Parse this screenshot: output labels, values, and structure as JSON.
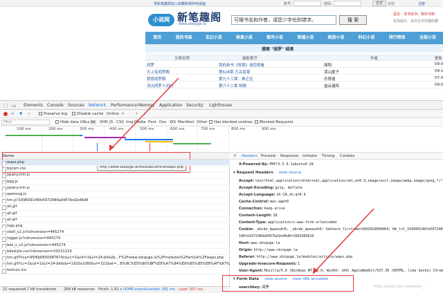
{
  "site": {
    "topbar": {
      "notice": "将新笔趣阁加入收藏和保存到桌面",
      "account_label": "账号:",
      "password_label": "密码:",
      "login_button": "登录",
      "remember": "记住",
      "register": "注册"
    },
    "logo": {
      "badge": "小说网",
      "title": "新笔趣阁",
      "subtitle": "www.xbiquge.la"
    },
    "search": {
      "value": "可搜书名和作者，请您少字也别错字。",
      "button": "搜 索"
    },
    "side_links": [
      "留言：求书找书。我的书架",
      "友情提示：请点击浏览器收藏"
    ],
    "nav": [
      "首页",
      "我的书架",
      "玄幻小说",
      "修真小说",
      "都市小说",
      "穿越小说",
      "网游小说",
      "科幻小说",
      "排行榜单",
      "全部小说"
    ],
    "results_title": "搜索 \"阎罗\" 结果",
    "table_headers": [
      "文章名称",
      "最新章节",
      "作者",
      "更新"
    ],
    "rows": [
      {
        "name": "阎罗",
        "chapter": "我的新书《将夜》请您观看",
        "author": "简阳",
        "date": "09-0"
      },
      {
        "name": "天上有阎罗殿",
        "chapter": "第628章 万古有尊",
        "author": "漆山墨子",
        "date": "09-1"
      },
      {
        "name": "我修阎罗殿",
        "chapter": "第九十三章：神之往",
        "author": "乐得逍",
        "date": "07-0"
      },
      {
        "name": "流光阎罗人间行",
        "chapter": "第六十二章 相救",
        "author": "益云涵风",
        "date": "09-0"
      }
    ]
  },
  "devtools": {
    "tabs": [
      "Elements",
      "Console",
      "Sources",
      "Network",
      "Performance",
      "Memory",
      "Application",
      "Security",
      "Lighthouse"
    ],
    "active_tab": "Network",
    "toolbar1": {
      "preserve_log": "Preserve log",
      "disable_cache": "Disable cache",
      "online": "Online"
    },
    "filter_placeholder": "Filter",
    "toolbar2": {
      "hide_data_urls": "Hide data URLs",
      "types": [
        "All",
        "XHR",
        "JS",
        "CSS",
        "Img",
        "Media",
        "Font",
        "Doc",
        "WS",
        "Manifest",
        "Other"
      ],
      "active_type": "All",
      "blocked_cookies": "Has blocked cookies",
      "blocked_requests": "Blocked Requests"
    },
    "timeline_labels": [
      "100 ms",
      "200 ms",
      "300 ms",
      "400 ms",
      "500 ms",
      "600 ms",
      "700 ms",
      "800 ms",
      "900 ms"
    ],
    "name_header": "Name",
    "requests": [
      "waps.php",
      "bqcsm.css",
      "jquery.min.js",
      "bqg.js",
      "jquery.min.js",
      "opensug.js",
      "hm.js?169609146fe5972484a0957bd1b46d6",
      "all.gif",
      "all.gif",
      "all.gif",
      "logo.png",
      "shell_v2.js?cdnversion=445274",
      "logger.js?cdnversion=445274",
      "bds_s_v2.js?cdnversion=445274",
      "bdsstyle.css?cdnversion=20131219",
      "hm.gif?hca=95f6b6850087670c&cc=1&ck=1&cl=24-bit&ds...F%2Fwww.xbiquge.la%2Fmodules%2Farticle%2Fwaps.php",
      "hm.gif?cc=1&ck=1&cl=24-bit&ds=1920x1080&vl=321&et=...8%9C%E5%80%BF%E8%A7%84%E9%85%85%E8%AF%87%E7%",
      "favicon.ico"
    ],
    "tooltip": "http://www.xbiquge.la/modules/article/waps.php",
    "status": {
      "requests": "21 requests",
      "transferred": "4.7 kB transferred",
      "resources": "268 kB resources",
      "finish": "Finish: 1.61 s",
      "dcl": "DOMContentLoaded: 281 ms",
      "load": "Load: 507 ms"
    },
    "headers_tabs": [
      "Headers",
      "Preview",
      "Response",
      "Initiator",
      "Timing",
      "Cookies"
    ],
    "x_powered_by": {
      "name": "X-Powered-By:",
      "value": "PHP/5.5.9-1ubuntu4.29"
    },
    "request_headers_title": "Request Headers",
    "view_source": "view source",
    "request_headers": [
      {
        "name": "Accept:",
        "value": "text/html,application/xhtml+xml,application/xml;q=0.9,image/avif,image/webp,image/apng,*/*;q"
      },
      {
        "name": "Accept-Encoding:",
        "value": "gzip, deflate"
      },
      {
        "name": "Accept-Language:",
        "value": "zh-CN,zh;q=0.9"
      },
      {
        "name": "Cache-Control:",
        "value": "max-age=0"
      },
      {
        "name": "Connection:",
        "value": "keep-alive"
      },
      {
        "name": "Content-Length:",
        "value": "28"
      },
      {
        "name": "Content-Type:",
        "value": "application/x-www-form-urlencoded"
      },
      {
        "name": "Cookie:",
        "value": "_abcde_qweasd=0; _abcde_qweasd=0; bdshare_firstime=1602919099464; Hm_lvt_169609146fe5972484"
      },
      {
        "name": "",
        "value": "146fe5972484a0957bd1b46d6=1602983610"
      },
      {
        "name": "Host:",
        "value": "www.xbiquge.la"
      },
      {
        "name": "Origin:",
        "value": "http://www.xbiquge.la"
      },
      {
        "name": "Referer:",
        "value": "http://www.xbiquge.la/modules/article/waps.php"
      },
      {
        "name": "Upgrade-Insecure-Requests:",
        "value": "1"
      },
      {
        "name": "User-Agent:",
        "value": "Mozilla/5.0 (Windows NT 10.0; Win64; x64) AppleWebKit/537.36 (KHTML, like Gecko) Chrome/8"
      }
    ],
    "form_data": {
      "title": "Form Data",
      "view_source": "view source",
      "view_url_encoded": "view URL encoded",
      "key": "searchkey:",
      "value": "阎罗"
    },
    "watermark": "https://blog.csdn.net/weixin_..."
  }
}
